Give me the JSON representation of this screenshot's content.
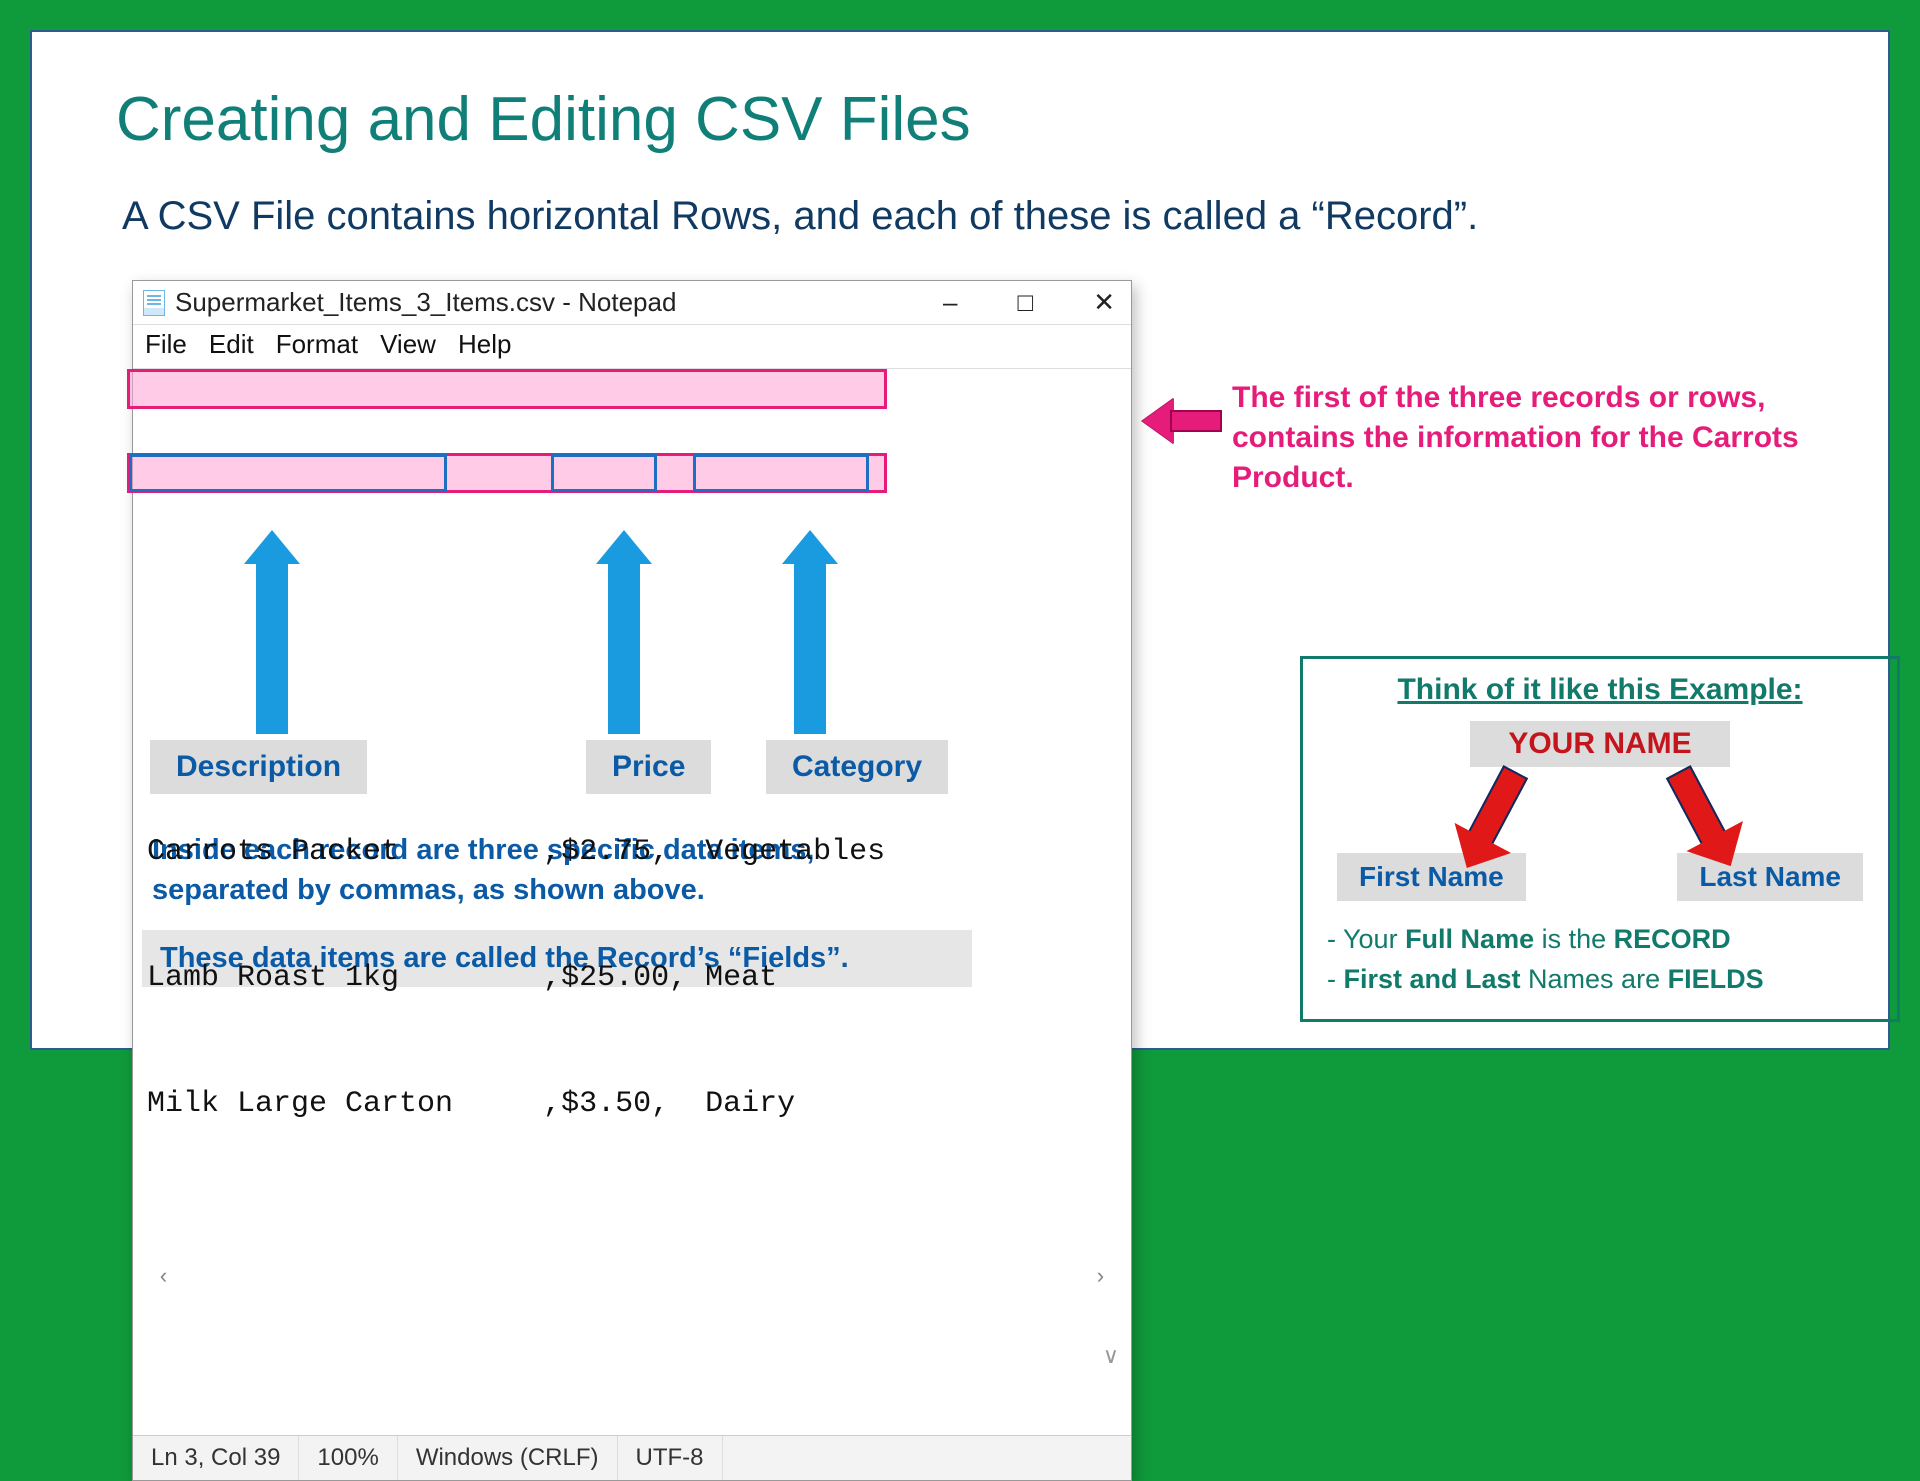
{
  "title": "Creating and Editing CSV Files",
  "subtitle": "A CSV File contains horizontal Rows, and each of these is called a “Record”.",
  "notepad": {
    "window_title": "Supermarket_Items_3_Items.csv - Notepad",
    "controls": {
      "min": "–",
      "max": "□",
      "close": "✕"
    },
    "menu": [
      "File",
      "Edit",
      "Format",
      "View",
      "Help"
    ],
    "rows": [
      "Carrots Packet        ,$2.75,  Vegetables",
      "Lamb Roast 1kg        ,$25.00, Meat",
      "Milk Large Carton     ,$3.50,  Dairy"
    ],
    "scroll_left": "‹",
    "scroll_right": "›",
    "scroll_down": "∨",
    "status": {
      "pos": "Ln 3, Col 39",
      "zoom": "100%",
      "eol": "Windows (CRLF)",
      "enc": "UTF-8"
    }
  },
  "pink_note": "The first of the three records or rows, contains the information for the Carrots Product.",
  "field_labels": {
    "description": "Description",
    "price": "Price",
    "category": "Category"
  },
  "blue_explain": "Inside each record are three specific data items, separated by commas, as shown above.",
  "fields_bar": "These data items are called the Record’s “Fields”.",
  "example": {
    "title": "Think of it like this Example:",
    "your_name": "YOUR NAME",
    "first": "First Name",
    "last": "Last Name",
    "note1_pre": "- Your ",
    "note1_b1": "Full Name",
    "note1_mid": " is the ",
    "note1_b2": "RECORD",
    "note2_pre": "- ",
    "note2_b1": "First and Last",
    "note2_mid": " Names are ",
    "note2_b2": "FIELDS"
  }
}
